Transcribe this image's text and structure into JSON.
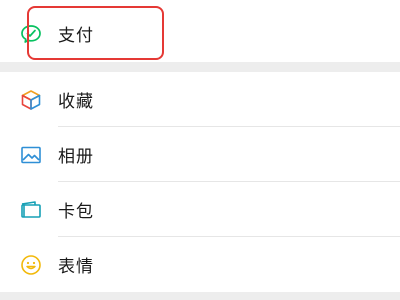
{
  "menu": {
    "pay": {
      "label": "支付",
      "icon": "pay-icon"
    },
    "items": [
      {
        "label": "收藏",
        "icon": "favorites-icon"
      },
      {
        "label": "相册",
        "icon": "album-icon"
      },
      {
        "label": "卡包",
        "icon": "card-wallet-icon"
      },
      {
        "label": "表情",
        "icon": "sticker-emoji-icon"
      }
    ]
  },
  "colors": {
    "background": "#ededed",
    "row_background": "#ffffff",
    "highlight_border": "#e53935",
    "pay_green": "#07c160",
    "album_blue": "#2f8fd6",
    "card_teal": "#16a0b5",
    "emoji_yellow": "#f2b90b"
  }
}
